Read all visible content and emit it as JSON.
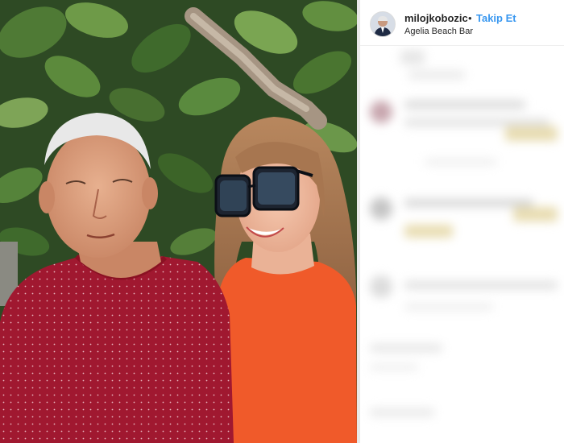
{
  "post": {
    "username": "milojkobozic",
    "separator": "•",
    "follow_label": "Takip Et",
    "location": "Agelia Beach Bar"
  },
  "colors": {
    "follow_blue": "#3897f0",
    "text_dark": "#262626",
    "sweater_red": "#9b1529",
    "top_orange": "#f05a2a"
  },
  "icons": {
    "avatar": "profile-avatar"
  }
}
